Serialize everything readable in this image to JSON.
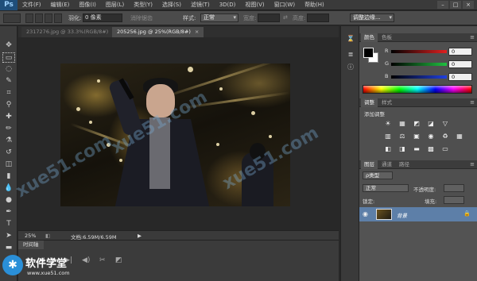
{
  "app": {
    "logo": "Ps"
  },
  "menu": [
    "文件(F)",
    "编辑(E)",
    "图像(I)",
    "图层(L)",
    "类型(Y)",
    "选择(S)",
    "滤镜(T)",
    "3D(D)",
    "视图(V)",
    "窗口(W)",
    "帮助(H)"
  ],
  "window_controls": [
    "–",
    "□",
    "×"
  ],
  "options": {
    "feather_label": "羽化:",
    "feather_value": "0 像素",
    "antialias_label": "消除锯齿",
    "style_label": "样式:",
    "style_value": "正常",
    "width_label": "宽度:",
    "height_label": "高度:",
    "refine_button": "调整边缘..."
  },
  "tabs": [
    {
      "label": "2317276.jpg @ 33.3%(RGB/8#)",
      "close": "×"
    },
    {
      "label": "205256.jpg @ 25%(RGB/8#)",
      "close": "×"
    }
  ],
  "status": {
    "zoom": "25%",
    "doc": "文档:6.59M/6.59M"
  },
  "timeline": {
    "tab": "时间轴"
  },
  "color_panel": {
    "tabs": [
      "颜色",
      "色板"
    ],
    "channels": [
      {
        "label": "R",
        "value": "0",
        "color": "#d42a2a"
      },
      {
        "label": "G",
        "value": "0",
        "color": "#2ab84a"
      },
      {
        "label": "B",
        "value": "0",
        "color": "#2a4ad4"
      }
    ]
  },
  "adjust_panel": {
    "tabs": [
      "调整",
      "样式"
    ],
    "title": "添加调整",
    "row1": [
      "☀",
      "▦",
      "◩",
      "◪",
      "▽"
    ],
    "row2": [
      "▥",
      "⚖",
      "▣",
      "◉",
      "♻",
      "▦"
    ],
    "row3": [
      "◧",
      "◨",
      "▬",
      "▩",
      "▭"
    ]
  },
  "layers_panel": {
    "tabs": [
      "图层",
      "通道",
      "路径"
    ],
    "kind_label": "ρ类型",
    "blend_mode": "正常",
    "opacity_label": "不透明度:",
    "lock_label": "锁定:",
    "fill_label": "填充:",
    "layer_name": "背景"
  },
  "watermark": "xue51.com",
  "site_logo": {
    "badge": "✱",
    "name": "软件学堂",
    "url": "www.xue51.com"
  },
  "accent_color": "#5d7fa8"
}
